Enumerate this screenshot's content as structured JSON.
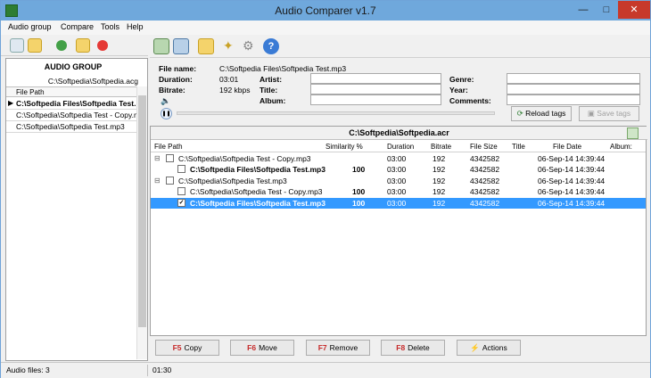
{
  "window": {
    "title": "Audio Comparer v1.7"
  },
  "menu": [
    "Audio group",
    "Compare",
    "Tools",
    "Help"
  ],
  "audio_group": {
    "title": "AUDIO GROUP",
    "path": "C:\\Softpedia\\Softpedia.acg",
    "column": "File Path",
    "rows": [
      "C:\\Softpedia Files\\Softpedia Test.",
      "C:\\Softpedia\\Softpedia Test - Copy.mp3",
      "C:\\Softpedia\\Softpedia Test.mp3"
    ]
  },
  "info": {
    "file_name_label": "File name:",
    "file_name": "C:\\Softpedia Files\\Softpedia Test.mp3",
    "duration_label": "Duration:",
    "duration": "03:01",
    "bitrate_label": "Bitrate:",
    "bitrate": "192 kbps",
    "artist_label": "Artist:",
    "title_label": "Title:",
    "album_label": "Album:",
    "genre_label": "Genre:",
    "year_label": "Year:",
    "comments_label": "Comments:",
    "reload_tags": "Reload tags",
    "save_tags": "Save tags"
  },
  "result": {
    "title": "C:\\Softpedia\\Softpedia.acr",
    "columns": [
      "File Path",
      "Similarity %",
      "Duration",
      "Bitrate",
      "File Size",
      "Title",
      "File Date",
      "Album:"
    ],
    "rows": [
      {
        "path": "C:\\Softpedia\\Softpedia Test - Copy.mp3",
        "sim": "",
        "dur": "03:00",
        "bit": "192",
        "size": "4342582",
        "date": "06-Sep-14 14:39:44"
      },
      {
        "path": "C:\\Softpedia Files\\Softpedia Test.mp3",
        "sim": "100",
        "dur": "03:00",
        "bit": "192",
        "size": "4342582",
        "date": "06-Sep-14 14:39:44"
      },
      {
        "path": "C:\\Softpedia\\Softpedia Test.mp3",
        "sim": "",
        "dur": "03:00",
        "bit": "192",
        "size": "4342582",
        "date": "06-Sep-14 14:39:44"
      },
      {
        "path": "C:\\Softpedia\\Softpedia Test - Copy.mp3",
        "sim": "100",
        "dur": "03:00",
        "bit": "192",
        "size": "4342582",
        "date": "06-Sep-14 14:39:44"
      },
      {
        "path": "C:\\Softpedia Files\\Softpedia Test.mp3",
        "sim": "100",
        "dur": "03:00",
        "bit": "192",
        "size": "4342582",
        "date": "06-Sep-14 14:39:44"
      }
    ]
  },
  "actions": {
    "f5": "F5",
    "copy": "Copy",
    "f6": "F6",
    "move": "Move",
    "f7": "F7",
    "remove": "Remove",
    "f8": "F8",
    "delete": "Delete",
    "actions": "Actions"
  },
  "status": {
    "files": "Audio files: 3",
    "time": "01:30"
  }
}
